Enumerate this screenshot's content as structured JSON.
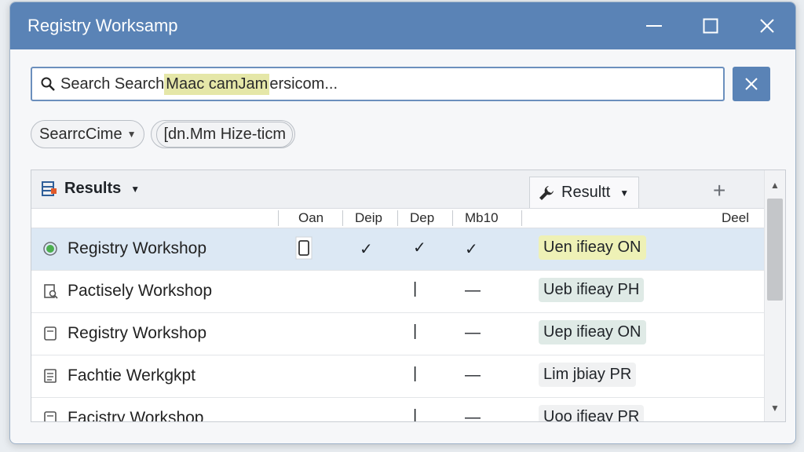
{
  "window": {
    "title": "Registry Worksamp"
  },
  "window_controls": {
    "minimize": "—",
    "maximize": "☐",
    "close": "✕"
  },
  "search": {
    "prefix": "Search Search ",
    "highlight": "Maac camJam",
    "suffix": "ersicom...",
    "clear_icon": "close-icon"
  },
  "chips": [
    {
      "label": "SearrcCime"
    },
    {
      "label": "[dn.Mm Hize-ticm"
    }
  ],
  "panel": {
    "header_title": "Results",
    "tab_label": "Resultt",
    "plus": "+",
    "columns": [
      "Oan",
      "Deip",
      "Dep",
      "Mb10",
      "Deel"
    ]
  },
  "rows": [
    {
      "name": "Registry Workshop",
      "c1": "☐",
      "c2": "✓",
      "c3": "✓",
      "c4": "✓",
      "status": "Uen ifieay ON",
      "status_style": "yellow",
      "icon": "radio-selected-icon",
      "selected": true
    },
    {
      "name": "Pactisely Workshop",
      "c1": "",
      "c2": "",
      "c3": "|",
      "c4": "—",
      "status": "Ueb ifieay PH",
      "status_style": "teal",
      "icon": "search-document-icon",
      "selected": false
    },
    {
      "name": "Registry Workshop",
      "c1": "",
      "c2": "",
      "c3": "|",
      "c4": "—",
      "status": "Uep ifieay ON",
      "status_style": "teal",
      "icon": "document-icon",
      "selected": false
    },
    {
      "name": "Fachtie Werkgkpt",
      "c1": "",
      "c2": "",
      "c3": "|",
      "c4": "—",
      "status": "Lim jbiay PR",
      "status_style": "plain",
      "icon": "document-lines-icon",
      "selected": false
    },
    {
      "name": "Facistry Workshop",
      "c1": "",
      "c2": "",
      "c3": "|",
      "c4": "—",
      "status": "Uoo ifieay PR",
      "status_style": "plain",
      "icon": "document-icon",
      "selected": false
    }
  ],
  "colors": {
    "titlebar": "#5a83b6",
    "accent": "#5a83b6",
    "selection": "#dce8f4"
  }
}
